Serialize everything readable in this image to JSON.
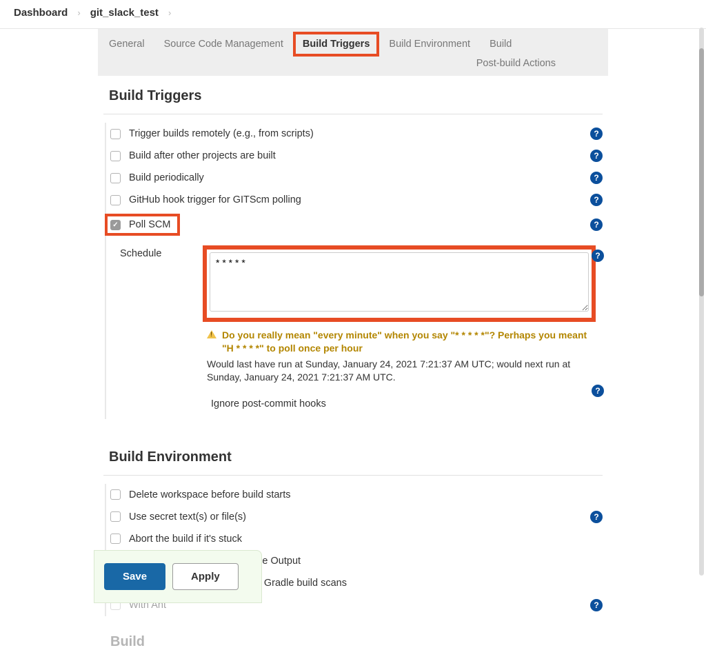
{
  "breadcrumb": {
    "items": [
      "Dashboard",
      "git_slack_test"
    ]
  },
  "tabs": {
    "general": "General",
    "scm": "Source Code Management",
    "build_triggers": "Build Triggers",
    "build_env": "Build Environment",
    "build": "Build",
    "post_build": "Post-build Actions"
  },
  "sections": {
    "build_triggers_title": "Build Triggers",
    "build_env_title": "Build Environment",
    "build_title": "Build"
  },
  "triggers": {
    "remote": "Trigger builds remotely (e.g., from scripts)",
    "after_other": "Build after other projects are built",
    "periodically": "Build periodically",
    "github_hook": "GitHub hook trigger for GITScm polling",
    "poll_scm": "Poll SCM",
    "poll_scm_checked": true
  },
  "schedule": {
    "label": "Schedule",
    "value": "* * * * *",
    "warning": "Do you really mean \"every minute\" when you say \"* * * * *\"? Perhaps you meant \"H * * * *\" to poll once per hour",
    "note": "Would last have run at Sunday, January 24, 2021 7:21:37 AM UTC; would next run at Sunday, January 24, 2021 7:21:37 AM UTC.",
    "ignore_hooks": "Ignore post-commit hooks"
  },
  "env": {
    "delete_ws": "Delete workspace before build starts",
    "secret": "Use secret text(s) or file(s)",
    "abort_stuck": "Abort the build if it's stuck",
    "timestamps": "Add timestamps to the Console Output",
    "gradle_scan": "Inspect build log for published Gradle build scans",
    "with_ant": "With Ant"
  },
  "buttons": {
    "save": "Save",
    "apply": "Apply"
  },
  "help_glyph": "?"
}
